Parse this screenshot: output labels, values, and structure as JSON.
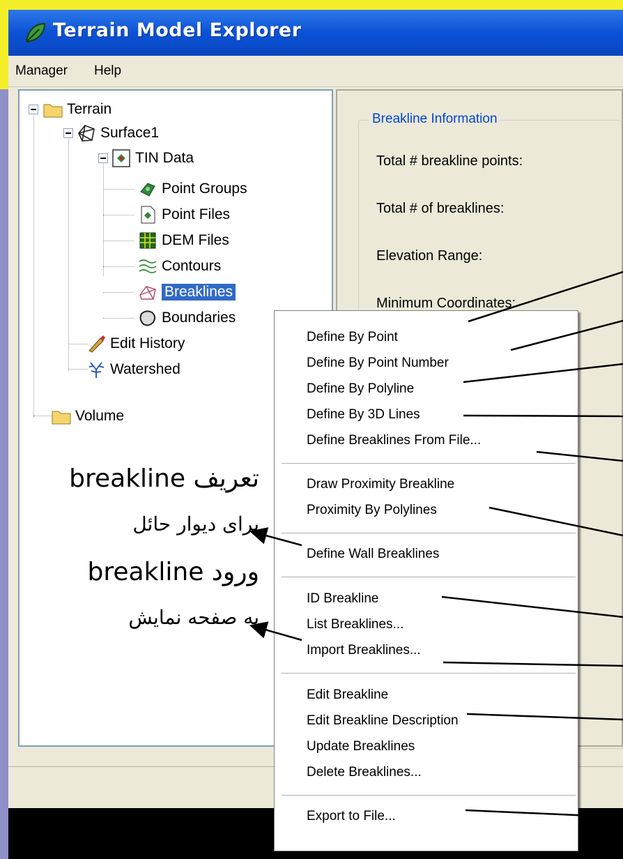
{
  "window": {
    "title": "Terrain Model Explorer"
  },
  "menubar": {
    "items": [
      "Manager",
      "Help"
    ]
  },
  "tree": {
    "nodes": [
      {
        "label": "Terrain",
        "icon": "folder-icon"
      },
      {
        "label": "Surface1",
        "icon": "surface-icon"
      },
      {
        "label": "TIN Data",
        "icon": "tin-data-icon"
      },
      {
        "label": "Point Groups",
        "icon": "point-groups-icon"
      },
      {
        "label": "Point Files",
        "icon": "point-files-icon"
      },
      {
        "label": "DEM Files",
        "icon": "dem-files-icon"
      },
      {
        "label": "Contours",
        "icon": "contours-icon"
      },
      {
        "label": "Breaklines",
        "icon": "breaklines-icon",
        "selected": true
      },
      {
        "label": "Boundaries",
        "icon": "boundaries-icon"
      },
      {
        "label": "Edit History",
        "icon": "edit-history-icon"
      },
      {
        "label": "Watershed",
        "icon": "watershed-icon"
      },
      {
        "label": "Volume",
        "icon": "folder-icon"
      }
    ]
  },
  "info_panel": {
    "group_title": "Breakline Information",
    "labels": [
      "Total # breakline points:",
      "Total # of breaklines:",
      "Elevation Range:",
      "Minimum Coordinates:"
    ]
  },
  "context_menu": {
    "groups": [
      [
        "Define By Point",
        "Define By Point Number",
        "Define By Polyline",
        "Define By 3D Lines",
        "Define Breaklines From File..."
      ],
      [
        "Draw Proximity Breakline",
        "Proximity By Polylines"
      ],
      [
        "Define Wall Breaklines"
      ],
      [
        "ID Breakline",
        "List Breaklines...",
        "Import Breaklines..."
      ],
      [
        "Edit Breakline",
        "Edit Breakline Description",
        "Update Breaklines",
        "Delete Breaklines..."
      ],
      [
        "Export to File..."
      ]
    ]
  },
  "annotations": {
    "wall_line1": "تعریف breakline",
    "wall_line2": "برای دیوار حائل",
    "import_line1": "ورود breakline",
    "import_line2": "به صفحه نمایش"
  },
  "colors": {
    "titlebar": "#0a52d6",
    "slide_top": "#f5ef2a",
    "selection": "#316ac5",
    "group_title": "#0046d5"
  }
}
